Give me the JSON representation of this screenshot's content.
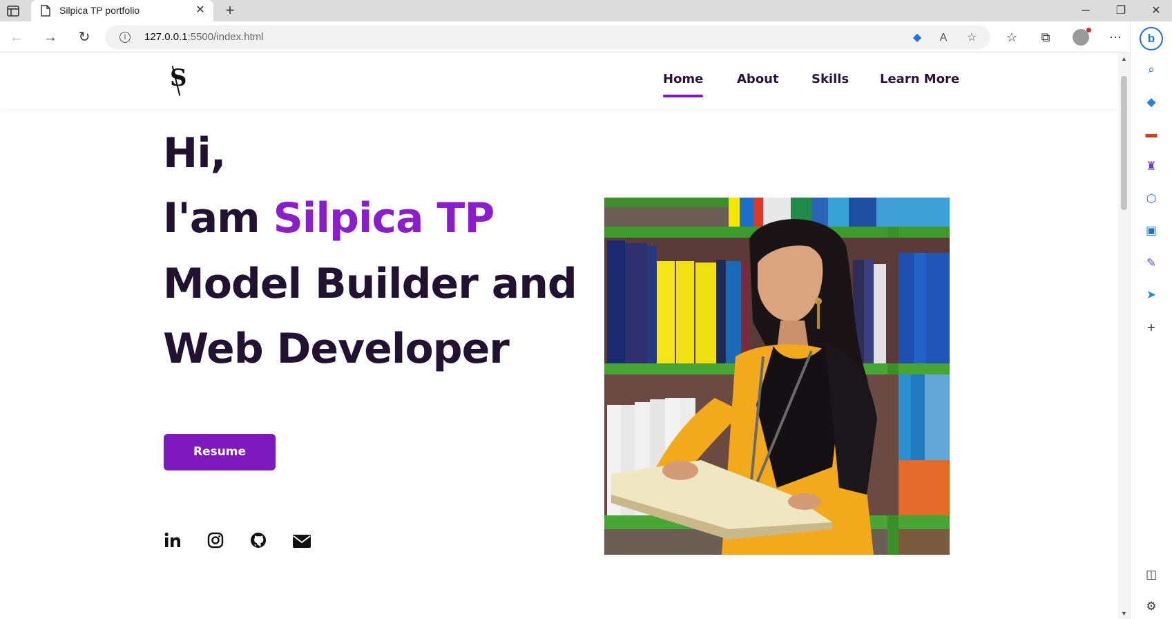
{
  "browser": {
    "tab_title": "Silpica TP portfolio",
    "url_host": "127.0.0.1",
    "url_rest": ":5500/index.html"
  },
  "header": {
    "logo": "S",
    "nav": [
      "Home",
      "About",
      "Skills",
      "Learn More"
    ],
    "active": "Home"
  },
  "hero": {
    "line1": "Hi,",
    "line2_prefix": "I'am ",
    "name": "Silpica TP",
    "line3": "Model Builder and",
    "line4": "Web Developer",
    "button": "Resume"
  },
  "social_icons": [
    "linkedin-icon",
    "instagram-icon",
    "github-icon",
    "mail-icon"
  ],
  "colors": {
    "accent": "#8a1ec9",
    "button": "#7d19bd",
    "heading": "#221232"
  }
}
